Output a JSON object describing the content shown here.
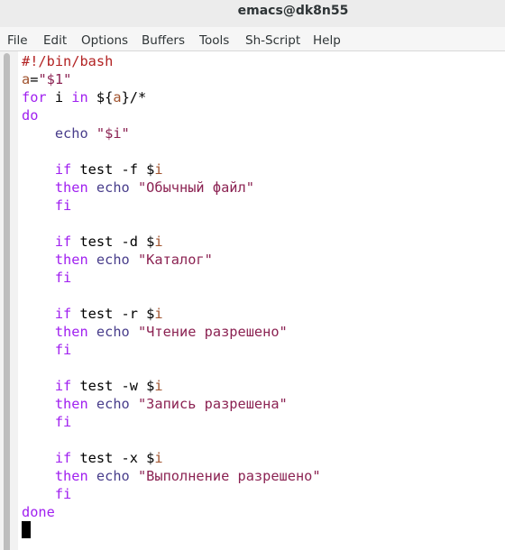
{
  "window": {
    "title": "emacs@dk8n55"
  },
  "menu": {
    "items": [
      "File",
      "Edit",
      "Options",
      "Buffers",
      "Tools",
      "Sh-Script",
      "Help"
    ]
  },
  "colors": {
    "comment": "#b22222",
    "keyword": "#a020f0",
    "variable": "#a0522d",
    "builtin": "#483d8b",
    "string": "#8b2252"
  },
  "code": {
    "l1": {
      "shebang": "#!/bin/bash"
    },
    "l2": {
      "var": "a",
      "eq": "=",
      "str": "\"$1\""
    },
    "l3": {
      "kw_for": "for",
      "sp1": " i ",
      "kw_in": "in",
      "sp2": " ${",
      "var": "a",
      "rest": "}/*"
    },
    "l4": {
      "kw": "do"
    },
    "l5": {
      "indent": "    ",
      "builtin": "echo",
      "sp": " ",
      "str": "\"$i\""
    },
    "l6": {
      "text": ""
    },
    "b1": {
      "if_indent": "    ",
      "kw_if": "if",
      "test": " test -f $",
      "var": "i",
      "then_indent": "    ",
      "kw_then": "then",
      "sp1": " ",
      "echo": "echo",
      "sp2": " ",
      "str": "\"Обычный файл\"",
      "fi_indent": "    ",
      "kw_fi": "fi"
    },
    "b2": {
      "if_indent": "    ",
      "kw_if": "if",
      "test": " test -d $",
      "var": "i",
      "then_indent": "    ",
      "kw_then": "then",
      "sp1": " ",
      "echo": "echo",
      "sp2": " ",
      "str": "\"Каталог\"",
      "fi_indent": "    ",
      "kw_fi": "fi"
    },
    "b3": {
      "if_indent": "    ",
      "kw_if": "if",
      "test": " test -r $",
      "var": "i",
      "then_indent": "    ",
      "kw_then": "then",
      "sp1": " ",
      "echo": "echo",
      "sp2": " ",
      "str": "\"Чтение разрешено\"",
      "fi_indent": "    ",
      "kw_fi": "fi"
    },
    "b4": {
      "if_indent": "    ",
      "kw_if": "if",
      "test": " test -w $",
      "var": "i",
      "then_indent": "    ",
      "kw_then": "then",
      "sp1": " ",
      "echo": "echo",
      "sp2": " ",
      "str": "\"Запись разрешена\"",
      "fi_indent": "    ",
      "kw_fi": "fi"
    },
    "b5": {
      "if_indent": "    ",
      "kw_if": "if",
      "test": " test -x $",
      "var": "i",
      "then_indent": "    ",
      "kw_then": "then",
      "sp1": " ",
      "echo": "echo",
      "sp2": " ",
      "str": "\"Выполнение разрешено\"",
      "fi_indent": "    ",
      "kw_fi": "fi"
    },
    "done": {
      "kw": "done"
    }
  }
}
